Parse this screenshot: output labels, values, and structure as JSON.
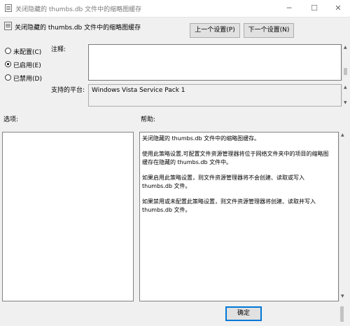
{
  "window": {
    "title": "关闭隐藏的 thumbs.db 文件中的缩略图缓存",
    "controls": {
      "minimize": "─",
      "maximize": "☐",
      "close": "✕"
    }
  },
  "header": {
    "title": "关闭隐藏的 thumbs.db 文件中的缩略图缓存",
    "prev_button": "上一个设置(P)",
    "next_button": "下一个设置(N)"
  },
  "state_options": [
    {
      "label": "未配置(C)",
      "checked": false
    },
    {
      "label": "已启用(E)",
      "checked": true
    },
    {
      "label": "已禁用(D)",
      "checked": false
    }
  ],
  "comment": {
    "label": "注释:",
    "value": ""
  },
  "platform": {
    "label": "支持的平台:",
    "value": "Windows Vista Service Pack 1"
  },
  "options": {
    "label": "选项:"
  },
  "help": {
    "label": "帮助:",
    "paragraphs": [
      "关闭隐藏的 thumbs.db 文件中的缩略图缓存。",
      "使用此策略设置,可配置文件资源管理器将位于网络文件夹中的项目的缩略图缓存在隐藏的 thumbs.db 文件中。",
      "如果启用此策略设置，则文件资源管理器将不会创建、读取或写入 thumbs.db 文件。",
      "如果禁用或未配置此策略设置，则文件资源管理器将创建、读取并写入 thumbs.db 文件。"
    ]
  },
  "footer": {
    "ok_button": "确定"
  }
}
